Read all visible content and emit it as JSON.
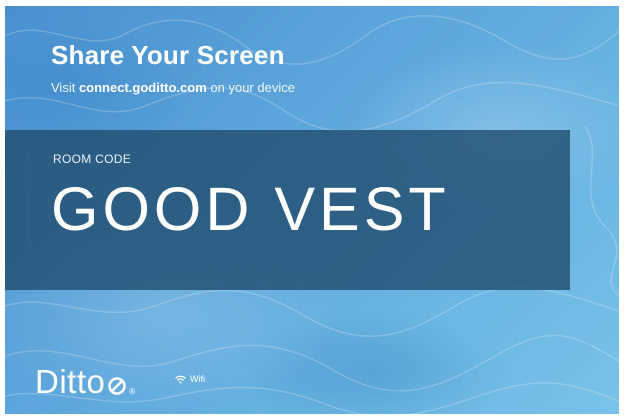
{
  "header": {
    "title": "Share Your Screen",
    "instruction_prefix": "Visit ",
    "instruction_domain": "connect.goditto.com",
    "instruction_suffix": " on your device"
  },
  "room": {
    "label": "ROOM CODE",
    "code": "GOOD VEST"
  },
  "footer": {
    "logo_text": "Ditto",
    "logo_registered": "®",
    "network_icon": "wifi-icon",
    "network_label": "Wifi"
  },
  "colors": {
    "background_water": "#5fa8dc",
    "code_panel": "#224e70",
    "text": "#ffffff"
  }
}
